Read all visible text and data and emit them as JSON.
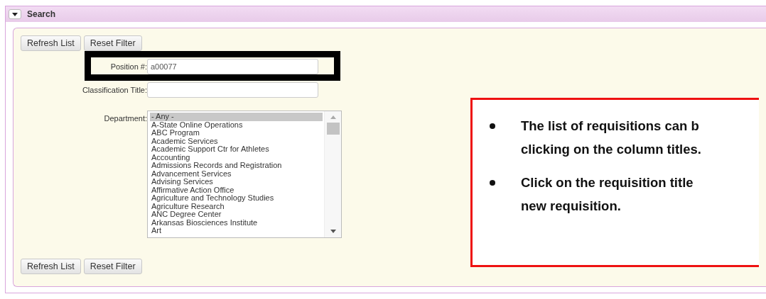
{
  "panel": {
    "title": "Search",
    "expanded": true
  },
  "top_buttons": [
    "Refresh List",
    "Reset Filter"
  ],
  "fields": [
    {
      "label": "Position #:",
      "value": "a00077",
      "highlighted": true
    },
    {
      "label": "Classification Title:"
    }
  ],
  "department": {
    "label": "Department:",
    "options": [
      {
        "text": "- Any -",
        "selected": true
      },
      {
        "text": "A-State Online Operations",
        "selected": false
      },
      {
        "text": "ABC Program",
        "selected": false
      },
      {
        "text": "Academic Services",
        "selected": false
      },
      {
        "text": "Academic Support Ctr for Athletes",
        "selected": false
      },
      {
        "text": "Accounting",
        "selected": false
      },
      {
        "text": "Admissions Records and Registration",
        "selected": false
      },
      {
        "text": "Advancement Services",
        "selected": false
      },
      {
        "text": "Advising Services",
        "selected": false
      },
      {
        "text": "Affirmative Action Office",
        "selected": false
      },
      {
        "text": "Agriculture and Technology Studies",
        "selected": false
      },
      {
        "text": "Agriculture Research",
        "selected": false
      },
      {
        "text": "ANC Degree Center",
        "selected": false
      },
      {
        "text": "Arkansas Biosciences Institute",
        "selected": false
      },
      {
        "text": "Art",
        "selected": false
      }
    ]
  },
  "bottom_buttons": [
    "Refresh List",
    "Reset Filter"
  ],
  "callout": {
    "bullets": [
      {
        "lines": [
          "The list of requisitions can b",
          "clicking on the column titles."
        ]
      },
      {
        "lines": [
          "Click on the requisition title",
          "new requisition."
        ]
      }
    ]
  }
}
